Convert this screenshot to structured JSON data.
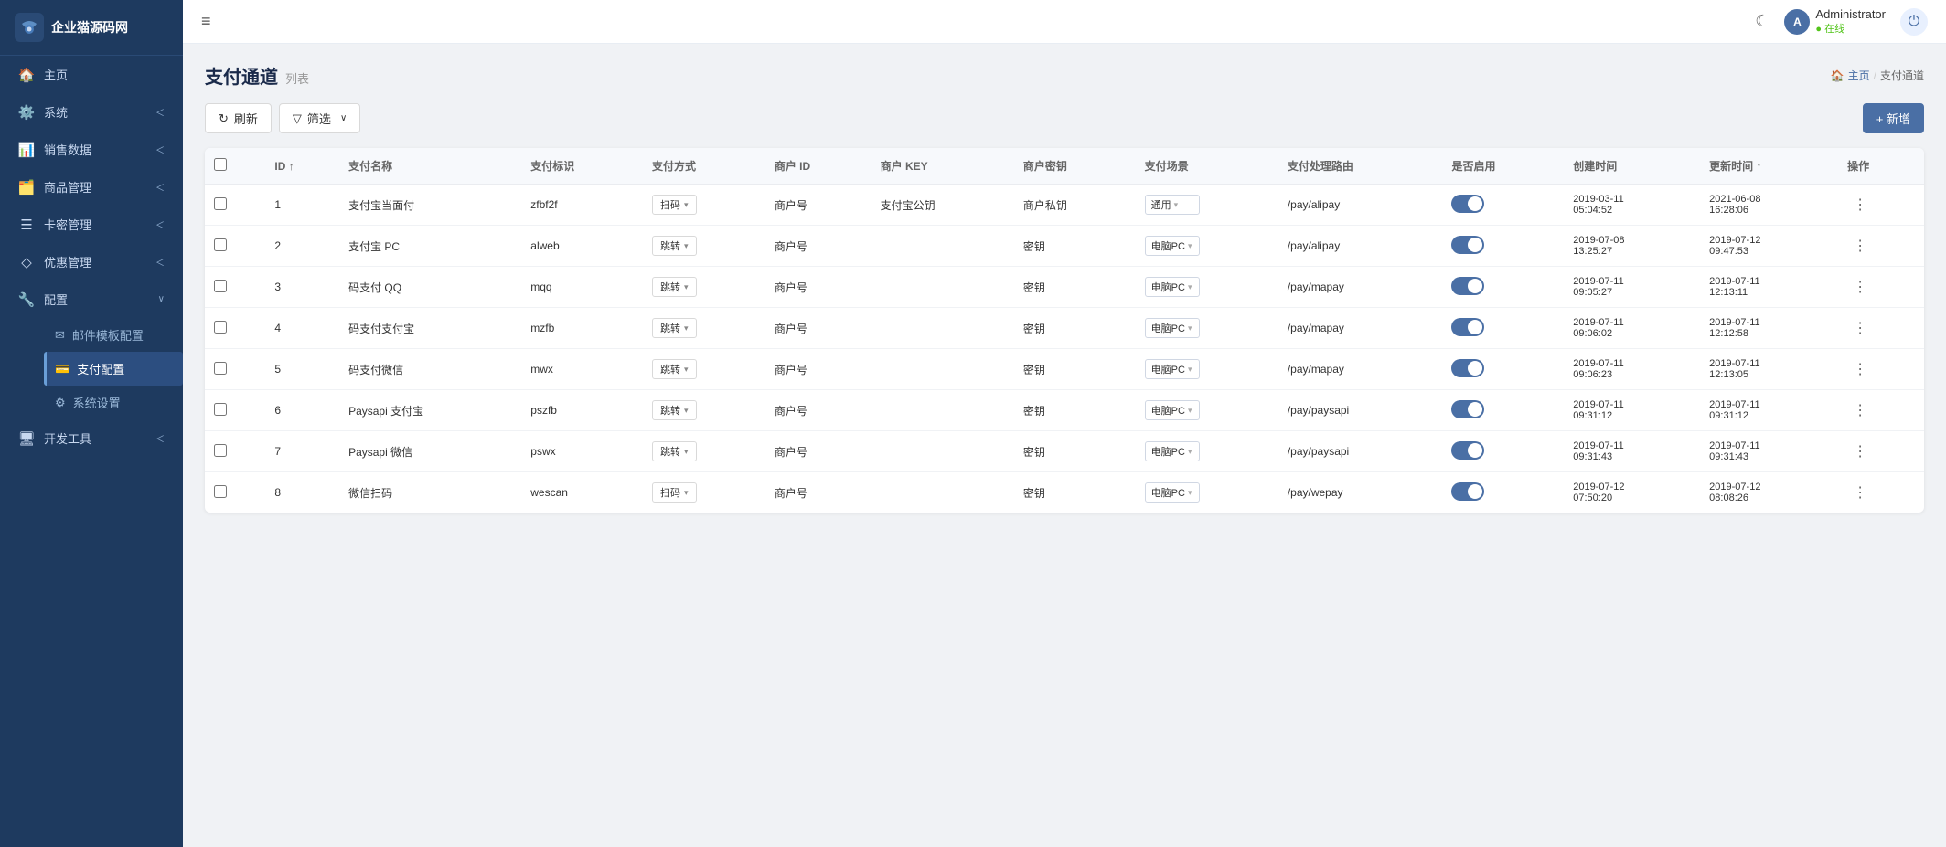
{
  "sidebar": {
    "logo_text": "企业猫源码网",
    "items": [
      {
        "id": "home",
        "label": "主页",
        "icon": "🏠",
        "arrow": false
      },
      {
        "id": "system",
        "label": "系统",
        "icon": "⚙️",
        "arrow": true
      },
      {
        "id": "sales",
        "label": "销售数据",
        "icon": "📊",
        "arrow": true
      },
      {
        "id": "goods",
        "label": "商品管理",
        "icon": "🗂️",
        "arrow": true
      },
      {
        "id": "cardkey",
        "label": "卡密管理",
        "icon": "☰",
        "arrow": true
      },
      {
        "id": "coupon",
        "label": "优惠管理",
        "icon": "♦",
        "arrow": true
      },
      {
        "id": "config",
        "label": "配置",
        "icon": "🔧",
        "arrow": true,
        "expanded": true
      },
      {
        "id": "email_tpl",
        "label": "邮件模板配置",
        "icon": "✉️",
        "arrow": false,
        "sub": true
      },
      {
        "id": "payment_config",
        "label": "支付配置",
        "icon": "💳",
        "arrow": false,
        "sub": true,
        "active": true
      },
      {
        "id": "sys_settings",
        "label": "系统设置",
        "icon": "⚡",
        "arrow": false,
        "sub": true
      },
      {
        "id": "devtools",
        "label": "开发工具",
        "icon": "🖥️",
        "arrow": true
      }
    ]
  },
  "header": {
    "menu_icon": "≡",
    "theme_icon": "☾",
    "user_name": "Administrator",
    "user_status": "● 在线",
    "power_icon": "⏻"
  },
  "page": {
    "title": "支付通道",
    "subtitle": "列表",
    "breadcrumb_home": "主页",
    "breadcrumb_current": "支付通道"
  },
  "toolbar": {
    "refresh_label": "刷新",
    "filter_label": "筛选",
    "add_label": "+ 新增"
  },
  "table": {
    "columns": [
      {
        "key": "checkbox",
        "label": ""
      },
      {
        "key": "id",
        "label": "ID ↑"
      },
      {
        "key": "name",
        "label": "支付名称"
      },
      {
        "key": "identifier",
        "label": "支付标识"
      },
      {
        "key": "method",
        "label": "支付方式"
      },
      {
        "key": "merchant_id",
        "label": "商户 ID"
      },
      {
        "key": "merchant_key",
        "label": "商户 KEY"
      },
      {
        "key": "merchant_secret",
        "label": "商户密钥"
      },
      {
        "key": "scene",
        "label": "支付场景"
      },
      {
        "key": "route",
        "label": "支付处理路由"
      },
      {
        "key": "enabled",
        "label": "是否启用"
      },
      {
        "key": "created_at",
        "label": "创建时间"
      },
      {
        "key": "updated_at",
        "label": "更新时间 ↑"
      },
      {
        "key": "action",
        "label": "操作"
      }
    ],
    "rows": [
      {
        "id": 1,
        "name": "支付宝当面付",
        "identifier": "zfbf2f",
        "method": "扫码",
        "merchant_id": "商户号",
        "merchant_key": "支付宝公钥",
        "merchant_secret": "商户私钥",
        "scene": "通用",
        "route": "/pay/alipay",
        "enabled": true,
        "created_at": "2019-03-11 05:04:52",
        "updated_at": "2021-06-08 16:28:06"
      },
      {
        "id": 2,
        "name": "支付宝 PC",
        "identifier": "alweb",
        "method": "跳转",
        "merchant_id": "商户号",
        "merchant_key": "",
        "merchant_secret": "密钥",
        "scene": "电脑PC",
        "route": "/pay/alipay",
        "enabled": true,
        "created_at": "2019-07-08 13:25:27",
        "updated_at": "2019-07-12 09:47:53"
      },
      {
        "id": 3,
        "name": "码支付 QQ",
        "identifier": "mqq",
        "method": "跳转",
        "merchant_id": "商户号",
        "merchant_key": "",
        "merchant_secret": "密钥",
        "scene": "电脑PC",
        "route": "/pay/mapay",
        "enabled": true,
        "created_at": "2019-07-11 09:05:27",
        "updated_at": "2019-07-11 12:13:11"
      },
      {
        "id": 4,
        "name": "码支付支付宝",
        "identifier": "mzfb",
        "method": "跳转",
        "merchant_id": "商户号",
        "merchant_key": "",
        "merchant_secret": "密钥",
        "scene": "电脑PC",
        "route": "/pay/mapay",
        "enabled": true,
        "created_at": "2019-07-11 09:06:02",
        "updated_at": "2019-07-11 12:12:58"
      },
      {
        "id": 5,
        "name": "码支付微信",
        "identifier": "mwx",
        "method": "跳转",
        "merchant_id": "商户号",
        "merchant_key": "",
        "merchant_secret": "密钥",
        "scene": "电脑PC",
        "route": "/pay/mapay",
        "enabled": true,
        "created_at": "2019-07-11 09:06:23",
        "updated_at": "2019-07-11 12:13:05"
      },
      {
        "id": 6,
        "name": "Paysapi 支付宝",
        "identifier": "pszfb",
        "method": "跳转",
        "merchant_id": "商户号",
        "merchant_key": "",
        "merchant_secret": "密钥",
        "scene": "电脑PC",
        "route": "/pay/paysapi",
        "enabled": true,
        "created_at": "2019-07-11 09:31:12",
        "updated_at": "2019-07-11 09:31:12"
      },
      {
        "id": 7,
        "name": "Paysapi 微信",
        "identifier": "pswx",
        "method": "跳转",
        "merchant_id": "商户号",
        "merchant_key": "",
        "merchant_secret": "密钥",
        "scene": "电脑PC",
        "route": "/pay/paysapi",
        "enabled": true,
        "created_at": "2019-07-11 09:31:43",
        "updated_at": "2019-07-11 09:31:43"
      },
      {
        "id": 8,
        "name": "微信扫码",
        "identifier": "wescan",
        "method": "扫码",
        "merchant_id": "商户号",
        "merchant_key": "",
        "merchant_secret": "密钥",
        "scene": "电脑PC",
        "route": "/pay/wepay",
        "enabled": true,
        "created_at": "2019-07-12 07:50:20",
        "updated_at": "2019-07-12 08:08:26"
      }
    ]
  },
  "colors": {
    "sidebar_bg": "#1e3a5f",
    "accent": "#4a6fa5",
    "toggle_on": "#4a6fa5",
    "header_bg": "#ffffff"
  }
}
